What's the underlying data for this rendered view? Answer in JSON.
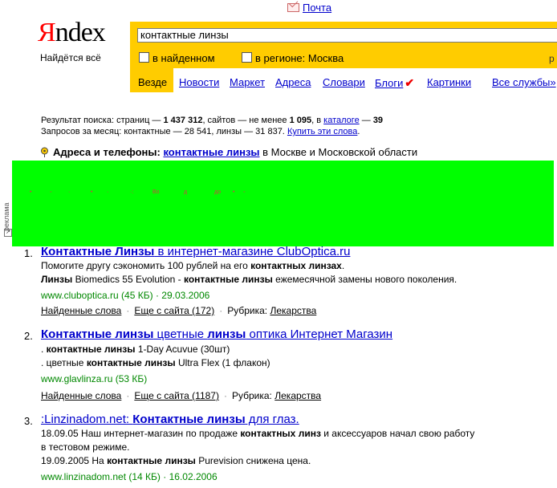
{
  "top": {
    "mail": "Почта"
  },
  "logo": {
    "ya": "Я",
    "ndex": "ndex",
    "tagline": "Найдётся всё"
  },
  "search": {
    "query": "контактные линзы",
    "opt_found": "в найденном",
    "opt_region": "в регионе: Москва",
    "right_link": "р"
  },
  "tabs": [
    "Везде",
    "Новости",
    "Маркет",
    "Адреса",
    "Словари",
    "Блоги",
    "Картинки",
    "Все службы»"
  ],
  "stats": {
    "line1_prefix": "Результат поиска: страниц —",
    "pages": "1 437 312",
    "line1_sites": ", сайтов — не менее",
    "sites": "1 095",
    "line1_in": ", в",
    "catalog": "каталоге",
    "line1_dash": "—",
    "catalog_count": "39",
    "line2": "Запросов за месяц: контактные — 28 541, линзы — 31 837.",
    "buy": "Купить эти слова",
    "line2_end": "."
  },
  "address": {
    "label": "Адреса и телефоны:",
    "link": "контактные линзы",
    "rest": "в Москве и Московской области"
  },
  "ad": {
    "label": "реклама",
    "arrow": "↗",
    "chars": [
      "•",
      "◦",
      "·",
      "•",
      "·",
      "·:",
      "Во",
      "д",
      "до",
      "•",
      "◦"
    ],
    "color": "#00ff00"
  },
  "results": [
    {
      "n": "1.",
      "t1": "Контактные Линзы",
      "t2": " в интернет-магазине ClubOptica.ru",
      "s1a": "Помогите другу сэкономить 100 рублей на его ",
      "s1b": "контактных линзах",
      "s1c": ".",
      "s2a": "Линзы",
      "s2b": " Biomedics 55 Evolution - ",
      "s2c": "контактные линзы",
      "s2d": " ежемесячной замены нового поколения.",
      "url": "www.cluboptica.ru (45 КБ)",
      "date": "· 29.03.2006",
      "words": "Найденные слова",
      "more": "Еще с сайта (172)",
      "rub": "Рубрика:",
      "rubl": "Лекарства"
    },
    {
      "n": "2.",
      "t1": "Контактные линзы",
      "t2": " цветные ",
      "t3": "линзы",
      "t4": " оптика Интернет Магазин",
      "s1a": ". ",
      "s1b": "контактные линзы",
      "s1c": " 1-Day Acuvue (30шт)",
      "s2a": ". цветные ",
      "s2b": "контактные линзы",
      "s2c": " Ultra Flex (1 флакон)",
      "url": "www.glavlinza.ru (53 КБ)",
      "words": "Найденные слова",
      "more": "Еще с сайта (1187)",
      "rub": "Рубрика:",
      "rubl": "Лекарства"
    },
    {
      "n": "3.",
      "t1": ":Linzinadom.net: ",
      "t2": "Контактные линзы",
      "t3": " для глаз.",
      "s1a": "18.09.05 Наш интернет-магазин по продаже ",
      "s1b": "контактных линз",
      "s1c": " и аксессуаров начал свою работу",
      "s2": "в тестовом режиме.",
      "s3a": "19.09.2005 На ",
      "s3b": "контактные линзы",
      "s3c": " Purevision снижена цена.",
      "url": "www.linzinadom.net (14 КБ)",
      "date": "· 16.02.2006"
    }
  ]
}
